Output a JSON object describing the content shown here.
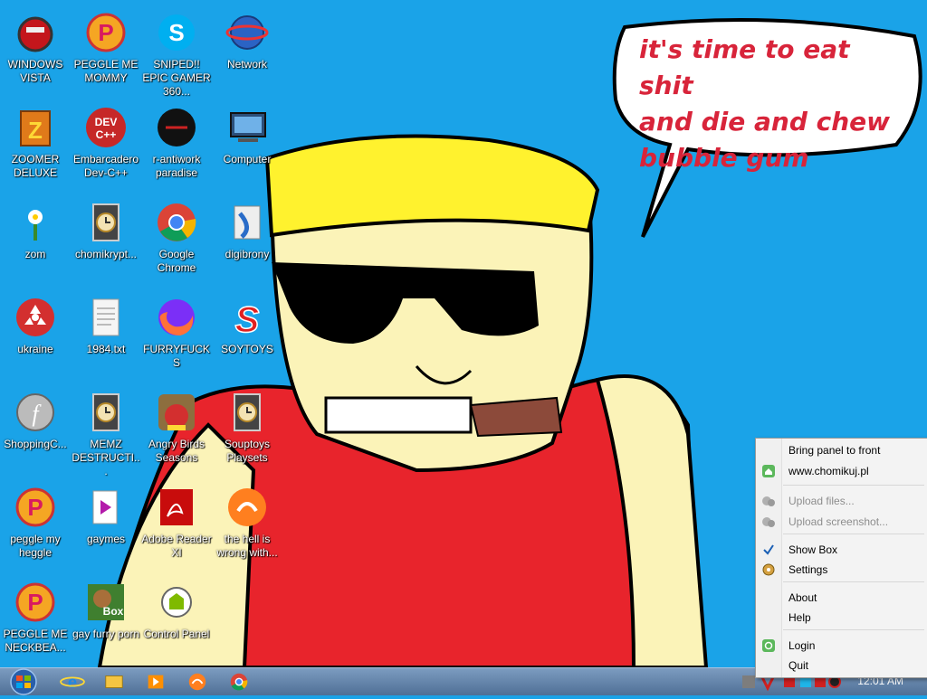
{
  "wallpaper": {
    "speech_text": [
      "it's time to eat shit",
      "and die and chew",
      "bubble gum"
    ]
  },
  "desktop_icons": [
    {
      "id": "windows-vista",
      "label": "WINDOWS VISTA",
      "icon": "red-bot-icon"
    },
    {
      "id": "peggle-me-mommy",
      "label": "PEGGLE ME MOMMY",
      "icon": "peggle-icon"
    },
    {
      "id": "sniped-epic-gamer",
      "label": "SNIPED!! EPIC GAMER 360...",
      "icon": "skype-icon"
    },
    {
      "id": "network",
      "label": "Network",
      "icon": "network-globe-icon"
    },
    {
      "id": "zoomer-deluxe",
      "label": "ZOOMER DELUXE",
      "icon": "zuma-icon"
    },
    {
      "id": "embarcadero-dev-cpp",
      "label": "Embarcadero Dev-C++",
      "icon": "devcpp-icon"
    },
    {
      "id": "r-antiwork-paradise",
      "label": "r-antiwork paradise",
      "icon": "dark-logo-icon"
    },
    {
      "id": "computer",
      "label": "Computer",
      "icon": "computer-icon"
    },
    {
      "id": "zom",
      "label": "zom",
      "icon": "flower-icon"
    },
    {
      "id": "chomikrypt",
      "label": "chomikrypt...",
      "icon": "clock-file-icon"
    },
    {
      "id": "google-chrome",
      "label": "Google Chrome",
      "icon": "chrome-icon"
    },
    {
      "id": "digibrony",
      "label": "digibrony",
      "icon": "document-blue-icon"
    },
    {
      "id": "ukraine",
      "label": "ukraine",
      "icon": "radiation-icon"
    },
    {
      "id": "1984-txt",
      "label": "1984.txt",
      "icon": "text-file-icon"
    },
    {
      "id": "furryfucks",
      "label": "FURRYFUCKS",
      "icon": "firefox-icon"
    },
    {
      "id": "soytoys",
      "label": "SOYTOYS",
      "icon": "red-s-icon"
    },
    {
      "id": "shoppingc",
      "label": "ShoppingC...",
      "icon": "flash-icon"
    },
    {
      "id": "memz-destructi",
      "label": "MEMZ DESTRUCTI...",
      "icon": "clock-file-icon"
    },
    {
      "id": "angry-birds-seasons",
      "label": "Angry Birds Seasons",
      "icon": "angry-birds-icon"
    },
    {
      "id": "souptoys-playsets",
      "label": "Souptoys Playsets",
      "icon": "clock-file-icon"
    },
    {
      "id": "peggle-my-heggle",
      "label": "peggle my heggle",
      "icon": "peggle-icon"
    },
    {
      "id": "gaymes",
      "label": "gaymes",
      "icon": "games-folder-icon"
    },
    {
      "id": "adobe-reader-xi",
      "label": "Adobe Reader XI",
      "icon": "adobe-reader-icon"
    },
    {
      "id": "the-hell-is-wrong",
      "label": "the hell is wrong with...",
      "icon": "uc-browser-icon"
    },
    {
      "id": "peggle-me-neckbea",
      "label": "PEGGLE ME NECKBEA...",
      "icon": "peggle-icon"
    },
    {
      "id": "gay-furry-porn",
      "label": "gay furry porn",
      "icon": "box-dog-icon"
    },
    {
      "id": "control-panel",
      "label": "Control Panel",
      "icon": "control-panel-icon"
    }
  ],
  "taskbar": {
    "start_icon": "windows-orb-icon",
    "pinned": [
      {
        "id": "ie",
        "icon": "internet-explorer-icon"
      },
      {
        "id": "explorer",
        "icon": "folder-icon"
      },
      {
        "id": "media-player",
        "icon": "media-player-icon"
      },
      {
        "id": "uc",
        "icon": "uc-browser-icon"
      },
      {
        "id": "chrome",
        "icon": "chrome-icon"
      }
    ],
    "clock": "12:01 AM"
  },
  "context_menu": {
    "items": [
      {
        "label": "Bring panel to front",
        "icon": "",
        "disabled": false
      },
      {
        "label": "www.chomikuj.pl",
        "icon": "home-icon",
        "disabled": false
      },
      {
        "label": "Upload files...",
        "icon": "upload-icon",
        "disabled": true
      },
      {
        "label": "Upload screenshot...",
        "icon": "upload-icon",
        "disabled": true
      },
      {
        "label": "Show Box",
        "icon": "check-icon",
        "disabled": false
      },
      {
        "label": "Settings",
        "icon": "gear-icon",
        "disabled": false
      },
      {
        "label": "About",
        "icon": "",
        "disabled": false
      },
      {
        "label": "Help",
        "icon": "",
        "disabled": false
      },
      {
        "label": "Login",
        "icon": "login-icon",
        "disabled": false
      },
      {
        "label": "Quit",
        "icon": "",
        "disabled": false
      }
    ]
  },
  "colors": {
    "desktop_bg": "#1aa3e8",
    "speech_text": "#d8243a",
    "shirt": "#e8242c",
    "skin": "#fbf3b8",
    "bandana": "#fff22e"
  }
}
